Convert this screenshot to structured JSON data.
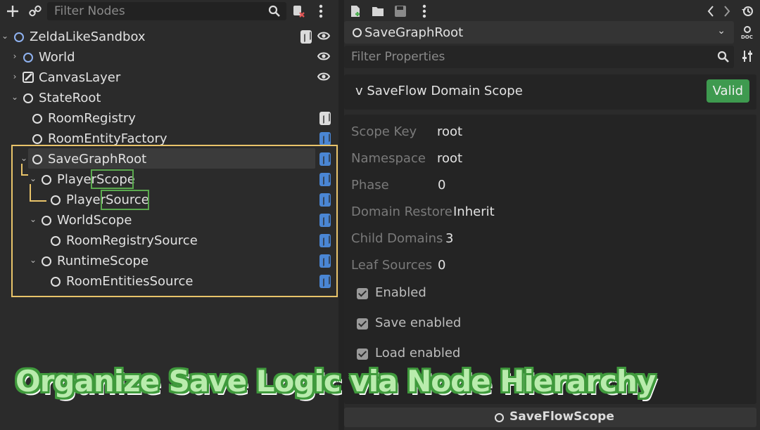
{
  "scene_dock": {
    "filter_placeholder": "Filter Nodes",
    "toolbar_icons": [
      "add-icon",
      "link-icon",
      "search-icon",
      "script-remove-icon",
      "menu-icon"
    ],
    "tree": [
      {
        "label": "ZeldaLikeSandbox",
        "icon": "node-icon",
        "expanded": true
      },
      {
        "label": "World",
        "icon": "node-icon",
        "expanded": false
      },
      {
        "label": "CanvasLayer",
        "icon": "canvas-layer-icon",
        "expanded": false
      },
      {
        "label": "StateRoot",
        "icon": "node-icon",
        "expanded": true
      },
      {
        "label": "RoomRegistry",
        "icon": "node-icon"
      },
      {
        "label": "RoomEntityFactory",
        "icon": "node-icon"
      },
      {
        "label": "SaveGraphRoot",
        "icon": "node-icon",
        "expanded": true,
        "selected": true
      },
      {
        "label_a": "Player",
        "label_b": "Scope",
        "icon": "node-icon",
        "expanded": true
      },
      {
        "label_a": "Player",
        "label_b": "Source",
        "icon": "node-icon"
      },
      {
        "label": "WorldScope",
        "icon": "node-icon",
        "expanded": true
      },
      {
        "label": "RoomRegistrySource",
        "icon": "node-icon"
      },
      {
        "label": "RuntimeScope",
        "icon": "node-icon",
        "expanded": true
      },
      {
        "label": "RoomEntitiesSource",
        "icon": "node-icon"
      }
    ]
  },
  "inspector": {
    "toolbar_icons": [
      "new-resource-icon",
      "open-folder-icon",
      "save-icon",
      "menu-icon",
      "back-arrow-icon",
      "forward-arrow-icon",
      "history-icon"
    ],
    "node_name": "SaveGraphRoot",
    "filter_placeholder": "Filter Properties",
    "section_title": "v SaveFlow Domain Scope",
    "status_badge": "Valid",
    "properties": [
      {
        "key": "Scope Key",
        "value": "root"
      },
      {
        "key": "Namespace",
        "value": "root"
      },
      {
        "key": "Phase",
        "value": "0"
      },
      {
        "key": "Domain Restore",
        "value": "Inherit"
      },
      {
        "key": "Child Domains",
        "value": "3"
      },
      {
        "key": "Leaf Sources",
        "value": "0"
      }
    ],
    "checks": [
      {
        "label": "Enabled",
        "checked": true
      },
      {
        "label": "Save enabled",
        "checked": true
      },
      {
        "label": "Load enabled",
        "checked": true
      }
    ],
    "bottom_type": "SaveFlowScope"
  },
  "caption": "Organize Save Logic via Node Hierarchy",
  "colors": {
    "highlight_yellow": "#e9c46a",
    "highlight_green": "#5aa84e",
    "valid_green": "#3e9a4f",
    "script_blue": "#4a86d4"
  }
}
